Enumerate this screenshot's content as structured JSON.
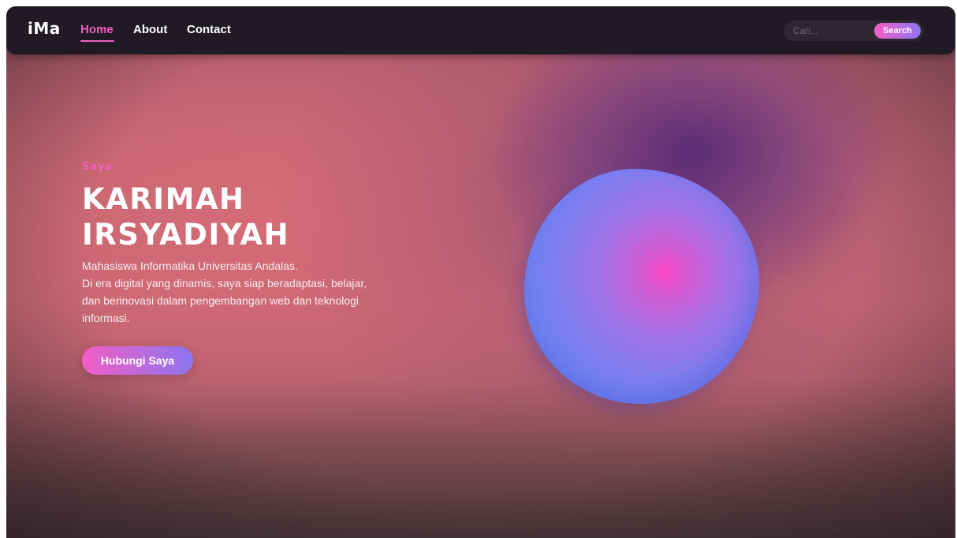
{
  "brand": {
    "logo": "iMa"
  },
  "nav": {
    "links": [
      {
        "label": "Home",
        "active": true
      },
      {
        "label": "About",
        "active": false
      },
      {
        "label": "Contact",
        "active": false
      }
    ]
  },
  "search": {
    "placeholder": "Cari...",
    "button_label": "Search"
  },
  "hero": {
    "eyebrow": "Saya",
    "name_line1": "KARIMAH",
    "name_line2": "IRSYADIYAH",
    "description_lines": [
      "Mahasiswa Informatika Universitas Andalas.",
      "Di era digital yang dinamis, saya siap beradaptasi, belajar,",
      "dan berinovasi dalam pengembangan web dan teknologi",
      "informasi."
    ],
    "cta_label": "Hubungi Saya"
  },
  "colors": {
    "accent_pink": "#f25fc5",
    "accent_violet": "#8c74f0",
    "navbar_bg": "#1f1a24",
    "orb_center": "#ff46c2",
    "orb_edge": "#5f7def"
  }
}
